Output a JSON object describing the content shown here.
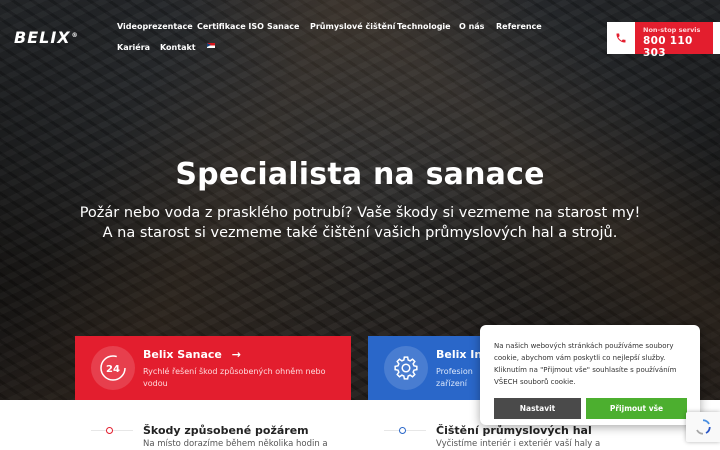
{
  "brand": {
    "logo_text": "BELIX",
    "reg_mark": "®"
  },
  "nav": {
    "items": [
      {
        "label": "Videoprezentace"
      },
      {
        "label": "Certifikace ISO"
      },
      {
        "label": "Sanace"
      },
      {
        "label": "Průmyslové čištění"
      },
      {
        "label": "Technologie"
      },
      {
        "label": "O nás"
      },
      {
        "label": "Reference"
      },
      {
        "label": "Kariéra"
      },
      {
        "label": "Kontakt"
      }
    ],
    "language_icon": "uk-flag-icon"
  },
  "service": {
    "label": "Non-stop servis",
    "phone": "800 110 303",
    "icon": "phone-icon"
  },
  "hero": {
    "title": "Specialista na sanace",
    "subtitle_line1": "Požár nebo voda z prasklého potrubí? Vaše škody si vezmeme na starost my!",
    "subtitle_line2": "A na starost si vezmeme také čištění vašich průmyslových hal a strojů."
  },
  "cards": [
    {
      "title": "Belix Sanace",
      "arrow": "→",
      "description": "Rychlé řešení škod způsobených ohněm nebo vodou",
      "icon": "24h-icon",
      "color": "#e31e2e",
      "sub_title": "Škody způsobené požárem",
      "sub_text": "Na místo dorazíme během několika hodin a"
    },
    {
      "title": "Belix In",
      "description": "Profesion zařízení",
      "icon": "gear-icon",
      "color": "#2a67c9",
      "sub_title": "Čištění průmyslových hal",
      "sub_text": "Vyčistíme interiér i exteriér vaší haly a"
    }
  ],
  "cookie": {
    "text": "Na našich webových stránkách používáme soubory cookie, abychom vám poskytli co nejlepší služby. Kliknutím na \"Přijmout vše\" souhlasíte s používáním VŠECH souborů cookie.",
    "settings_label": "Nastavit",
    "accept_label": "Přijmout vše"
  },
  "colors": {
    "accent_red": "#e31e2e",
    "accent_blue": "#2a67c9",
    "accept_green": "#4caf2f"
  }
}
